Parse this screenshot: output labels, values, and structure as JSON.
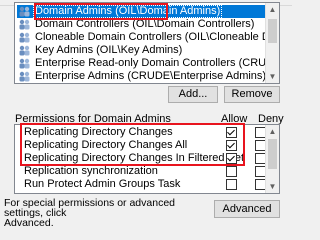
{
  "group_list": {
    "items": [
      {
        "label": "Domain Admins (OIL\\Domain Admins)",
        "selected": true,
        "icon": "group-icon"
      },
      {
        "label": "Domain Controllers (OIL\\Domain Controllers)",
        "selected": false,
        "icon": "group-icon"
      },
      {
        "label": "Cloneable Domain Controllers (OIL\\Cloneable Domain Controllers)",
        "selected": false,
        "icon": "group-icon"
      },
      {
        "label": "Key Admins (OIL\\Key Admins)",
        "selected": false,
        "icon": "group-icon"
      },
      {
        "label": "Enterprise Read-only Domain Controllers (CRUDE\\Enterprise Re...",
        "selected": false,
        "icon": "group-icon"
      },
      {
        "label": "Enterprise Admins (CRUDE\\Enterprise Admins)",
        "selected": false,
        "icon": "group-icon"
      }
    ]
  },
  "buttons": {
    "add": "Add...",
    "remove": "Remove",
    "advanced": "Advanced"
  },
  "permissions": {
    "header": "Permissions for Domain Admins",
    "allow_header": "Allow",
    "deny_header": "Deny",
    "rows": [
      {
        "name": "Replicating Directory Changes",
        "allow": true,
        "deny": false
      },
      {
        "name": "Replicating Directory Changes All",
        "allow": true,
        "deny": false
      },
      {
        "name": "Replicating Directory Changes In Filtered Set",
        "allow": true,
        "deny": false
      },
      {
        "name": "Replication synchronization",
        "allow": false,
        "deny": false
      },
      {
        "name": "Run Protect Admin Groups Task",
        "allow": false,
        "deny": false
      }
    ]
  },
  "footer": {
    "line1": "For special permissions or advanced settings, click",
    "line2": "Advanced."
  },
  "colors": {
    "selection": "#0078d7",
    "annotation_red": "#e8141e"
  }
}
